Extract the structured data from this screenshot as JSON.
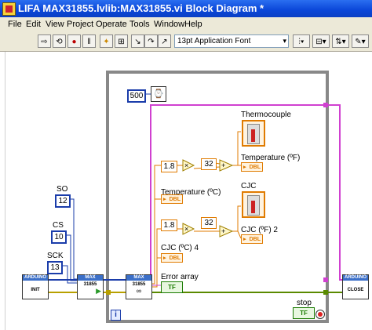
{
  "window": {
    "title": "LIFA MAX31855.lvlib:MAX31855.vi Block Diagram *"
  },
  "menu": [
    {
      "label": "File"
    },
    {
      "label": "Edit"
    },
    {
      "label": "View"
    },
    {
      "label": "Project"
    },
    {
      "label": "Operate"
    },
    {
      "label": "Tools"
    },
    {
      "label": "Window"
    },
    {
      "label": "Help"
    }
  ],
  "toolbar": {
    "font": "13pt Application Font"
  },
  "diagram": {
    "wait_ms": "500",
    "so_label": "SO",
    "so_value": "12",
    "cs_label": "CS",
    "cs_value": "10",
    "sck_label": "SCK",
    "sck_value": "13",
    "mult1": "1.8",
    "add1": "32",
    "mult2": "1.8",
    "add2": "32",
    "dbl": "DBL",
    "thermocouple": "Thermocouple",
    "temp_f": "Temperature (ºF)",
    "temp_c": "Temperature (ºC)",
    "cjc": "CJC",
    "cjc_f": "CJC (ºF) 2",
    "cjc_c": "CJC (ºC) 4",
    "error_array": "Error array",
    "tf": "TF",
    "stop": "stop",
    "init_head": "ARDUINO",
    "init": "INIT",
    "close_head": "ARDUINO",
    "close": "CLOSE",
    "max1_head": "MAX",
    "max1": "31855",
    "max2_head": "MAX",
    "max2": "31855",
    "info": "i"
  }
}
